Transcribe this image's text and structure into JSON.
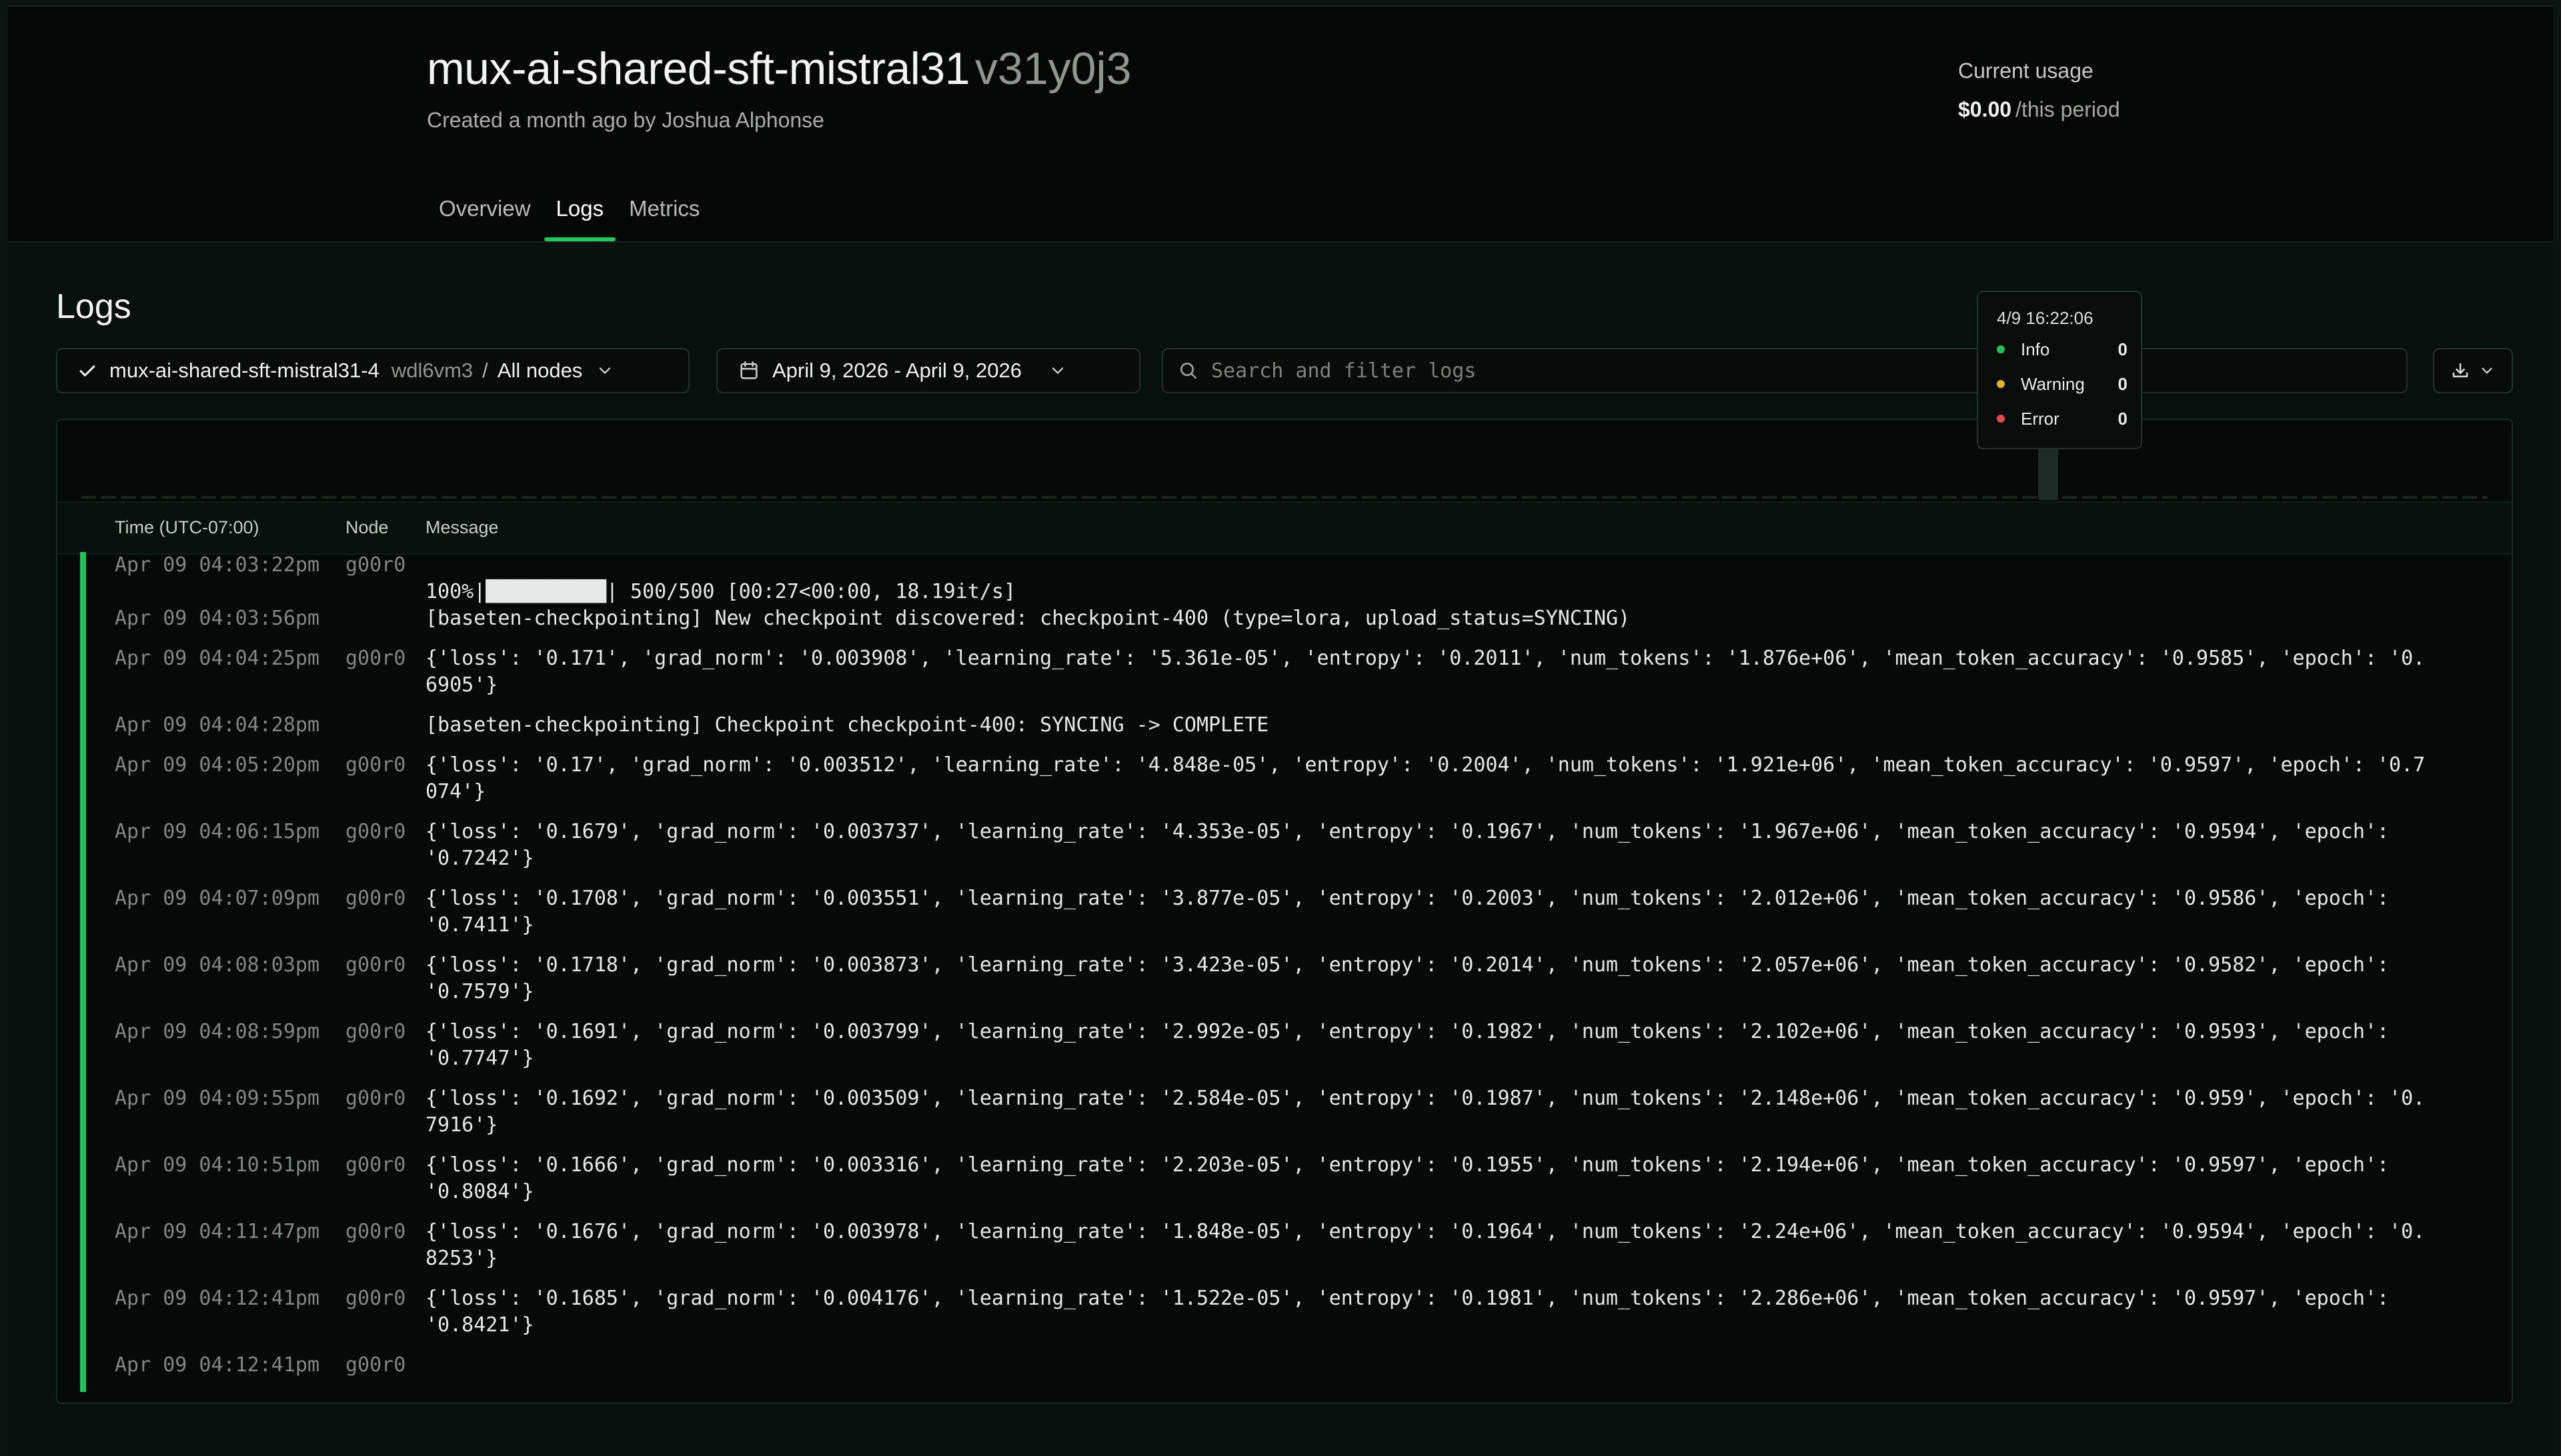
{
  "header": {
    "title": "mux-ai-shared-sft-mistral31",
    "version": "v31y0j3",
    "subtitle": "Created a month ago by Joshua Alphonse",
    "usage_label": "Current usage",
    "usage_value": "$0.00",
    "usage_period": "/this period"
  },
  "tabs": [
    {
      "label": "Overview",
      "active": false
    },
    {
      "label": "Logs",
      "active": true
    },
    {
      "label": "Metrics",
      "active": false
    }
  ],
  "logs": {
    "title": "Logs",
    "deployment_name": "mux-ai-shared-sft-mistral31-4",
    "deployment_hash": "wdl6vm3",
    "separator": "/",
    "nodes": "All nodes",
    "date_range": "April 9, 2026 - April 9, 2026",
    "search_placeholder": "Search and filter logs",
    "columns": {
      "time": "Time (UTC-07:00)",
      "node": "Node",
      "message": "Message"
    },
    "tooltip": {
      "timestamp": "4/9 16:22:06",
      "items": [
        {
          "label": "Info",
          "count": "0",
          "color": "#1fc35a"
        },
        {
          "label": "Warning",
          "count": "0",
          "color": "#e6b020"
        },
        {
          "label": "Error",
          "count": "0",
          "color": "#e5484d"
        }
      ]
    },
    "rows": [
      {
        "time": "Apr 09 04:03:22pm",
        "node": "g00r0",
        "message": "\n100%|██████████| 500/500 [00:27<00:00, 18.19it/s]"
      },
      {
        "time": "Apr 09 04:03:56pm",
        "node": "",
        "message": "[baseten-checkpointing] New checkpoint discovered: checkpoint-400 (type=lora, upload_status=SYNCING)"
      },
      {
        "time": "Apr 09 04:04:25pm",
        "node": "g00r0",
        "message": "{'loss': '0.171', 'grad_norm': '0.003908', 'learning_rate': '5.361e-05', 'entropy': '0.2011', 'num_tokens': '1.876e+06', 'mean_token_accuracy': '0.9585', 'epoch': '0.6905'}"
      },
      {
        "time": "Apr 09 04:04:28pm",
        "node": "",
        "message": "[baseten-checkpointing] Checkpoint checkpoint-400: SYNCING -> COMPLETE"
      },
      {
        "time": "Apr 09 04:05:20pm",
        "node": "g00r0",
        "message": "{'loss': '0.17', 'grad_norm': '0.003512', 'learning_rate': '4.848e-05', 'entropy': '0.2004', 'num_tokens': '1.921e+06', 'mean_token_accuracy': '0.9597', 'epoch': '0.7074'}"
      },
      {
        "time": "Apr 09 04:06:15pm",
        "node": "g00r0",
        "message": "{'loss': '0.1679', 'grad_norm': '0.003737', 'learning_rate': '4.353e-05', 'entropy': '0.1967', 'num_tokens': '1.967e+06', 'mean_token_accuracy': '0.9594', 'epoch': '0.7242'}"
      },
      {
        "time": "Apr 09 04:07:09pm",
        "node": "g00r0",
        "message": "{'loss': '0.1708', 'grad_norm': '0.003551', 'learning_rate': '3.877e-05', 'entropy': '0.2003', 'num_tokens': '2.012e+06', 'mean_token_accuracy': '0.9586', 'epoch': '0.7411'}"
      },
      {
        "time": "Apr 09 04:08:03pm",
        "node": "g00r0",
        "message": "{'loss': '0.1718', 'grad_norm': '0.003873', 'learning_rate': '3.423e-05', 'entropy': '0.2014', 'num_tokens': '2.057e+06', 'mean_token_accuracy': '0.9582', 'epoch': '0.7579'}"
      },
      {
        "time": "Apr 09 04:08:59pm",
        "node": "g00r0",
        "message": "{'loss': '0.1691', 'grad_norm': '0.003799', 'learning_rate': '2.992e-05', 'entropy': '0.1982', 'num_tokens': '2.102e+06', 'mean_token_accuracy': '0.9593', 'epoch': '0.7747'}"
      },
      {
        "time": "Apr 09 04:09:55pm",
        "node": "g00r0",
        "message": "{'loss': '0.1692', 'grad_norm': '0.003509', 'learning_rate': '2.584e-05', 'entropy': '0.1987', 'num_tokens': '2.148e+06', 'mean_token_accuracy': '0.959', 'epoch': '0.7916'}"
      },
      {
        "time": "Apr 09 04:10:51pm",
        "node": "g00r0",
        "message": "{'loss': '0.1666', 'grad_norm': '0.003316', 'learning_rate': '2.203e-05', 'entropy': '0.1955', 'num_tokens': '2.194e+06', 'mean_token_accuracy': '0.9597', 'epoch': '0.8084'}"
      },
      {
        "time": "Apr 09 04:11:47pm",
        "node": "g00r0",
        "message": "{'loss': '0.1676', 'grad_norm': '0.003978', 'learning_rate': '1.848e-05', 'entropy': '0.1964', 'num_tokens': '2.24e+06', 'mean_token_accuracy': '0.9594', 'epoch': '0.8253'}"
      },
      {
        "time": "Apr 09 04:12:41pm",
        "node": "g00r0",
        "message": "{'loss': '0.1685', 'grad_norm': '0.004176', 'learning_rate': '1.522e-05', 'entropy': '0.1981', 'num_tokens': '2.286e+06', 'mean_token_accuracy': '0.9597', 'epoch': '0.8421'}"
      },
      {
        "time": "Apr 09 04:12:41pm",
        "node": "g00r0",
        "message": ""
      }
    ]
  }
}
